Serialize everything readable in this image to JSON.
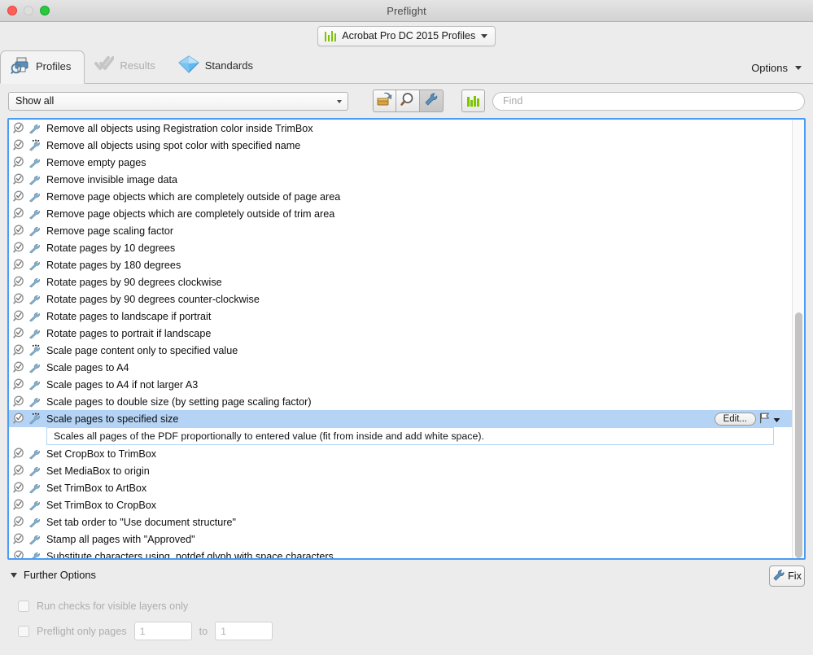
{
  "window": {
    "title": "Preflight",
    "traffic_lights": [
      "close-button",
      "minimize-button",
      "zoom-button"
    ]
  },
  "profile_chooser": {
    "label": "Acrobat Pro DC 2015 Profiles",
    "icon": "green-bars-icon",
    "caret": "chevron-down-icon"
  },
  "tabs": [
    {
      "label": "Profiles",
      "icon": "printer-magnifier-icon",
      "state": "active"
    },
    {
      "label": "Results",
      "icon": "checkmarks-icon",
      "state": "disabled"
    },
    {
      "label": "Standards",
      "icon": "blue-diamond-icon",
      "state": "normal"
    }
  ],
  "options_menu": {
    "label": "Options",
    "caret": "chevron-down-icon"
  },
  "filterbar": {
    "combo_value": "Show all",
    "tools": [
      {
        "name": "create-profile-icon",
        "pressed": false
      },
      {
        "name": "inspect-magnifier-icon",
        "pressed": false
      },
      {
        "name": "fixup-wrench-icon",
        "pressed": true
      }
    ],
    "find_icon": "green-bars-icon",
    "find_placeholder": "Find",
    "find_value": ""
  },
  "list": {
    "selected_index": 17,
    "rows": [
      {
        "label": "Remove all objects using Registration color inside TrimBox",
        "dots": false
      },
      {
        "label": "Remove all objects using spot color with specified name",
        "dots": true
      },
      {
        "label": "Remove empty pages",
        "dots": false
      },
      {
        "label": "Remove invisible image data",
        "dots": false
      },
      {
        "label": "Remove page objects which are completely outside of page area",
        "dots": false
      },
      {
        "label": "Remove page objects which are completely outside of trim area",
        "dots": false
      },
      {
        "label": "Remove page scaling factor",
        "dots": false
      },
      {
        "label": "Rotate pages by 10 degrees",
        "dots": false
      },
      {
        "label": "Rotate pages by 180 degrees",
        "dots": false
      },
      {
        "label": "Rotate pages by 90 degrees clockwise",
        "dots": false
      },
      {
        "label": "Rotate pages by 90 degrees counter-clockwise",
        "dots": false
      },
      {
        "label": "Rotate pages to landscape if portrait",
        "dots": false
      },
      {
        "label": "Rotate pages to portrait if landscape",
        "dots": false
      },
      {
        "label": "Scale page content only to specified value",
        "dots": true
      },
      {
        "label": "Scale pages to A4",
        "dots": false
      },
      {
        "label": "Scale pages to A4 if not larger A3",
        "dots": false
      },
      {
        "label": "Scale pages to double size (by setting page scaling factor)",
        "dots": false
      },
      {
        "label": "Scale pages to specified size",
        "dots": true
      },
      {
        "label": "Set CropBox to TrimBox",
        "dots": false
      },
      {
        "label": "Set MediaBox to origin",
        "dots": false
      },
      {
        "label": "Set TrimBox to ArtBox",
        "dots": false
      },
      {
        "label": "Set TrimBox to CropBox",
        "dots": false
      },
      {
        "label": "Set tab order to \"Use document structure\"",
        "dots": false
      },
      {
        "label": "Stamp all pages with \"Approved\"",
        "dots": false
      },
      {
        "label": "Substitute characters using .notdef glyph with space characters",
        "dots": false
      }
    ],
    "selected_description": "Scales all pages of the PDF proportionally to entered value (fit from inside and add white space).",
    "edit_button_label": "Edit...",
    "flag_icon": "flag-icon",
    "flag_caret": "chevron-down-icon",
    "scrollbar": {
      "thumb_top_pct": 44,
      "thumb_height_pct": 56
    }
  },
  "footer": {
    "further_options_label": "Further Options",
    "further_options_caret": "triangle-down-icon",
    "fix_button_label": "Fix",
    "fix_button_icon": "wrench-icon",
    "visible_layers_label": "Run checks for visible layers only",
    "preflight_pages_label": "Preflight only pages",
    "page_from_value": "1",
    "page_to_label": "to",
    "page_to_value": "1"
  },
  "colors": {
    "selection": "#b5d4f5",
    "focus_border": "#4b9cf5",
    "window_bg": "#ececec",
    "accent_green": "#7ec400",
    "wrench_blue": "#7fa8c9"
  }
}
